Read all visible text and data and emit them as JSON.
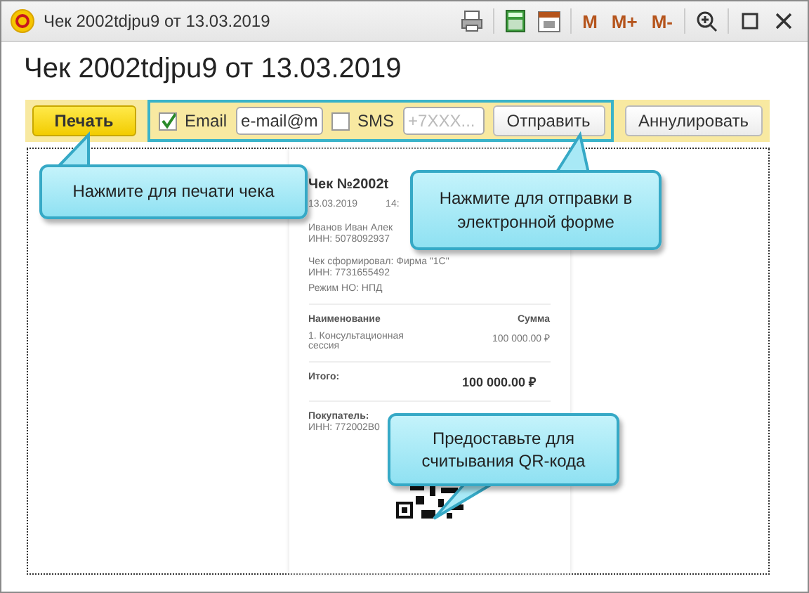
{
  "window": {
    "title": "Чек 2002tdjpu9 от 13.03.2019",
    "memory_buttons": [
      "M",
      "M+",
      "M-"
    ]
  },
  "heading": "Чек 2002tdjpu9 от 13.03.2019",
  "toolbar": {
    "print_button": "Печать",
    "email": {
      "label": "Email",
      "checked": true,
      "value": "e-mail@m"
    },
    "sms": {
      "label": "SMS",
      "checked": false,
      "placeholder": "+7XXX..."
    },
    "send_button": "Отправить",
    "cancel_button": "Аннулировать"
  },
  "receipt": {
    "title": "Чек №2002t",
    "date": "13.03.2019",
    "time": "14:",
    "seller_name": "Иванов Иван Алек",
    "seller_inn": "ИНН: 5078092937",
    "issuer": "Чек сформировал: Фирма \"1С\"",
    "issuer_inn": "ИНН: 7731655492",
    "tax_mode": "Режим НО: НПД",
    "columns": [
      "Наименование",
      "Сумма"
    ],
    "items": [
      {
        "name": "1. Консультационная сессия",
        "sum": "100 000.00 ₽"
      }
    ],
    "total_label": "Итого:",
    "total": "100 000.00 ₽",
    "buyer_label": "Покупатель:",
    "buyer_inn": "ИНН: 772002B0"
  },
  "callouts": [
    {
      "kind": "print",
      "text": "Нажмите для печати чека"
    },
    {
      "kind": "send",
      "text": "Нажмите для отправки в электронной форме"
    },
    {
      "kind": "qr",
      "text": "Предоставьте для считывания QR-кода"
    }
  ]
}
